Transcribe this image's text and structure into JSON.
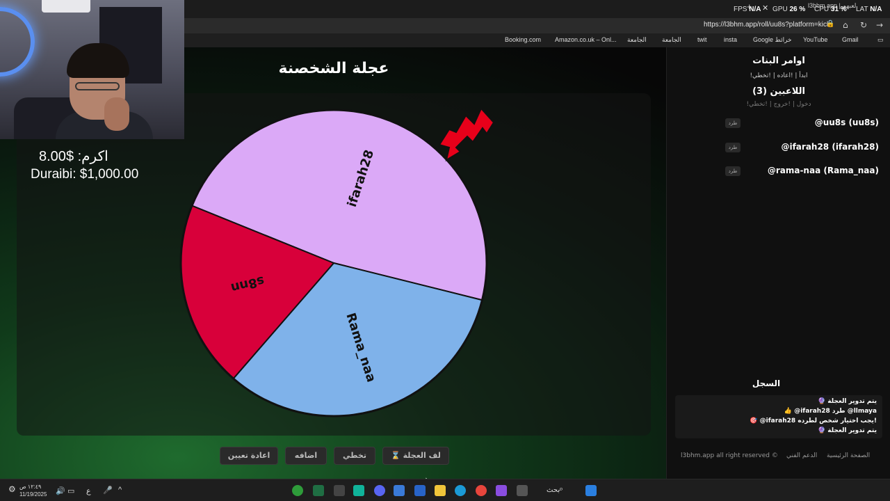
{
  "system_stats": {
    "fps_label": "FPS",
    "fps_value": "N/A",
    "gpu_label": "GPU",
    "gpu_value": "26 %",
    "cpu_label": "CPU",
    "cpu_value": "31 %",
    "lat_label": "LAT",
    "lat_value": "N/A",
    "tab_hint": "l3bhm.app | لعبهم"
  },
  "browser": {
    "url": "https://l3bhm.app/roll/uu8s?platform=kick",
    "bookmarks": [
      "Booking.com",
      "Amazon.co.uk – Onl...",
      "الجامعة",
      "الجامعة",
      "twit",
      "insta",
      "Google خرائط",
      "YouTube",
      "Gmail"
    ]
  },
  "overlay": {
    "money_line1": "اكرم: $8.00",
    "money_line2": "Duraibi: $1,000.00"
  },
  "wheel": {
    "title": "عجلة الشخصنة",
    "segments": [
      {
        "label": "ifarah28",
        "color": "#dba9f7",
        "start_deg": -68,
        "end_deg": 104
      },
      {
        "label": "Rama_naa",
        "color": "#7fb2ea",
        "start_deg": 104,
        "end_deg": 221
      },
      {
        "label": "s8nn",
        "color": "#d8003a",
        "start_deg": 221,
        "end_deg": 292
      }
    ]
  },
  "buttons": {
    "spin": "⌛ لف العجلة",
    "skip": "تخطي",
    "add": "اضافه",
    "reset": "اعادة تعيين"
  },
  "panel": {
    "commands_title": "اوامر البنات",
    "commands": "!ابدأ | !اعاده | !تخطي",
    "players_title": "اللاعبين (3)",
    "player_cmds": "!دخول | !خروج | !تخطي",
    "kick_label": "طرد",
    "players": [
      "@uu8s (uu8s)",
      "@ifarah28 (ifarah28)",
      "@rama-naa (Rama_naa)"
    ],
    "log_title": "السجل",
    "log": [
      "🔮 يتم تدوير العجلة",
      "👍 @ifarah28 طرد @llmaya",
      "🎯 @ifarah28 يجب اختيار شخص لطرده!",
      "🔮 يتم تدوير العجلة"
    ],
    "footer": {
      "home": "الصفحة الرئيسية",
      "support": "الدعم الفني",
      "copyright": "l3bhm.app all right reserved ©"
    }
  },
  "taskbar": {
    "time": "١٢:٤٩ ص",
    "date": "11/19/2025",
    "lang": "ع",
    "search": "بحث"
  }
}
